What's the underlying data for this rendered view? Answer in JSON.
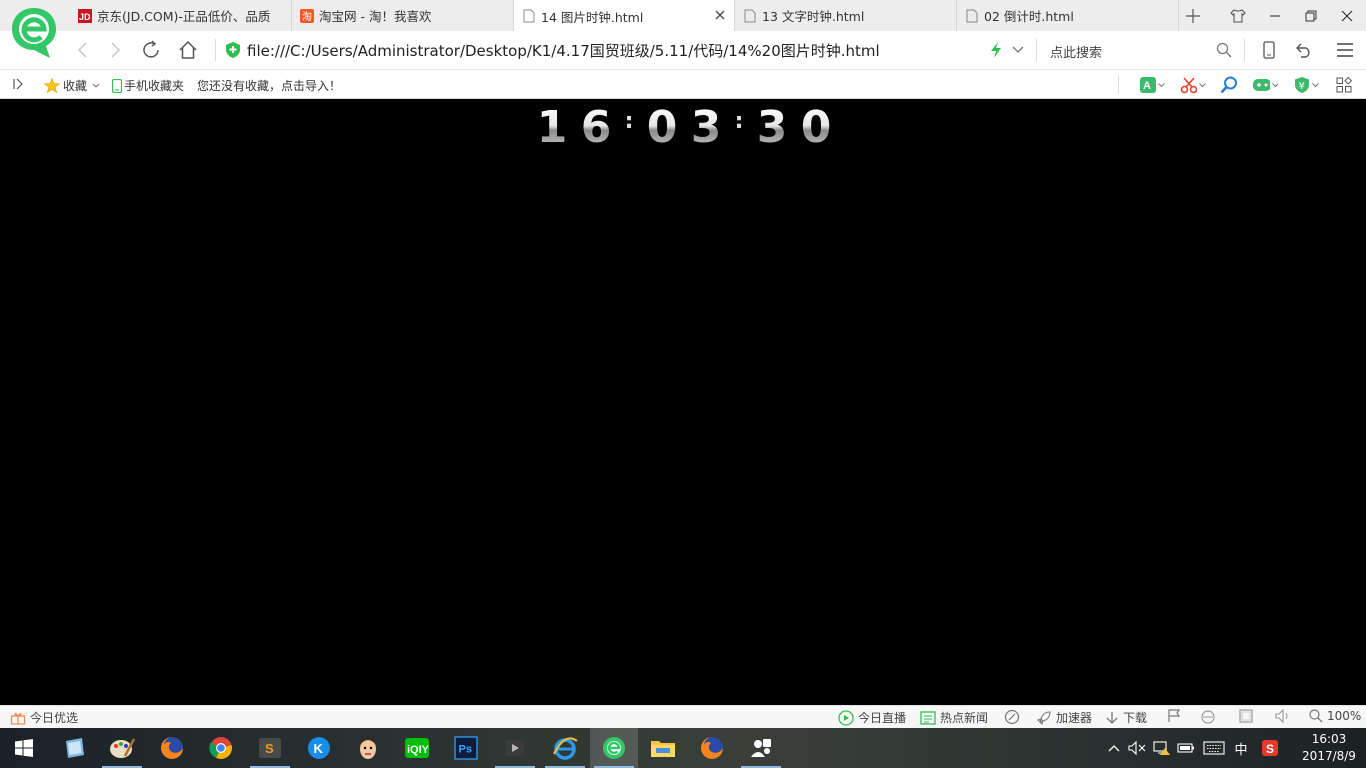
{
  "tabs": [
    {
      "title": "京东(JD.COM)-正品低价、品质",
      "icon": "jd-icon",
      "color": "#c81623"
    },
    {
      "title": "淘宝网 - 淘！我喜欢",
      "icon": "taobao-icon",
      "color": "#f05a23"
    },
    {
      "title": "14 图片时钟.html",
      "icon": "page-icon",
      "active": true
    },
    {
      "title": "13 文字时钟.html",
      "icon": "page-icon"
    },
    {
      "title": "02 倒计时.html",
      "icon": "page-icon"
    }
  ],
  "address": {
    "url": "file:///C:/Users/Administrator/Desktop/K1/4.17国贸班级/5.11/代码/14%20图片时钟.html",
    "search_placeholder": "点此搜索"
  },
  "bookmarks": {
    "favorites": "收藏",
    "mobile_favorites": "手机收藏夹",
    "empty_hint": "您还没有收藏，点击导入！"
  },
  "clock": {
    "h1": "1",
    "h2": "6",
    "sep1": ":",
    "m1": "0",
    "m2": "3",
    "sep2": ":",
    "s1": "3",
    "s2": "0"
  },
  "statusbar": {
    "today_picks": "今日优选",
    "live": "今日直播",
    "news": "热点新闻",
    "accelerator": "加速器",
    "download": "下载",
    "zoom": "100%"
  },
  "taskbar": {
    "ime": "中",
    "time": "16:03",
    "date": "2017/8/9"
  },
  "colors": {
    "brand_green": "#2fbf4f",
    "page_bg": "#000000",
    "tab_strip": "#ededed"
  }
}
